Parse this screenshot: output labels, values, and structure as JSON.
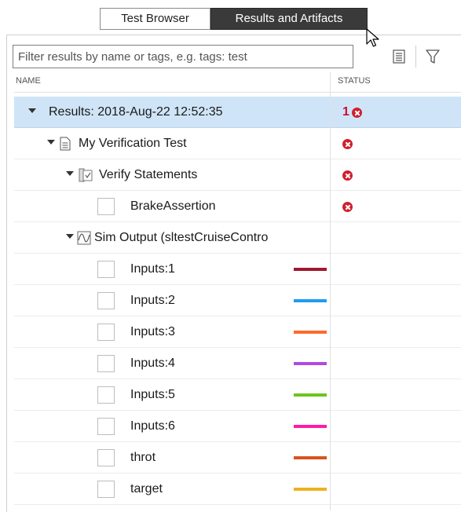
{
  "tabs": {
    "test_browser": "Test Browser",
    "results_artifacts": "Results and Artifacts"
  },
  "filter": {
    "placeholder": "Filter results by name or tags, e.g. tags: test"
  },
  "table": {
    "col_name": "NAME",
    "col_status": "STATUS"
  },
  "rows": {
    "results": {
      "label": "Results: 2018-Aug-22 12:52:35",
      "fail_count": "1"
    },
    "test": {
      "label": "My Verification Test"
    },
    "verify": {
      "label": "Verify Statements"
    },
    "brake": {
      "label": "BrakeAssertion"
    },
    "sim": {
      "label": "Sim Output (sltestCruiseContro"
    },
    "signals": [
      {
        "label": "Inputs:1",
        "color": "#a0182e"
      },
      {
        "label": "Inputs:2",
        "color": "#1f9bf0"
      },
      {
        "label": "Inputs:3",
        "color": "#ff6a2b"
      },
      {
        "label": "Inputs:4",
        "color": "#b04ae0"
      },
      {
        "label": "Inputs:5",
        "color": "#6cc51f"
      },
      {
        "label": "Inputs:6",
        "color": "#ff1aa8"
      },
      {
        "label": "throt",
        "color": "#d9531e"
      },
      {
        "label": "target",
        "color": "#edb120"
      }
    ]
  },
  "colors": {
    "selected_row": "#cfe5f7",
    "error": "#d11f2e",
    "active_tab": "#3a3a3a"
  }
}
